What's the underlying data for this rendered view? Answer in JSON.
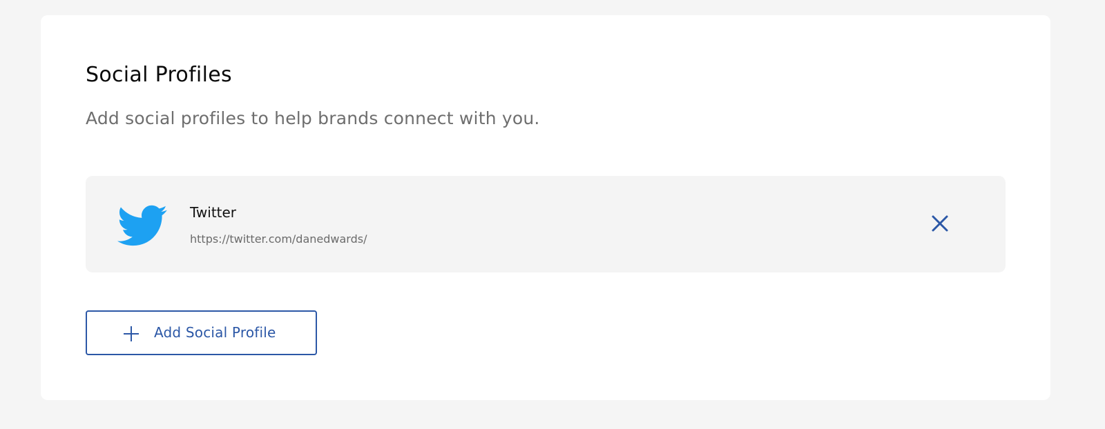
{
  "section": {
    "title": "Social Profiles",
    "subtitle": "Add social profiles to help brands connect with you."
  },
  "profiles": [
    {
      "name": "Twitter",
      "url": "https://twitter.com/danedwards/",
      "icon": "twitter-bird-icon",
      "remove_icon": "close-icon"
    }
  ],
  "add_button": {
    "label": "Add Social Profile",
    "icon": "plus-icon"
  },
  "colors": {
    "background": "#f5f5f5",
    "card": "#ffffff",
    "profile_row": "#f4f4f4",
    "accent": "#2b57a6",
    "twitter": "#1da1f2"
  }
}
